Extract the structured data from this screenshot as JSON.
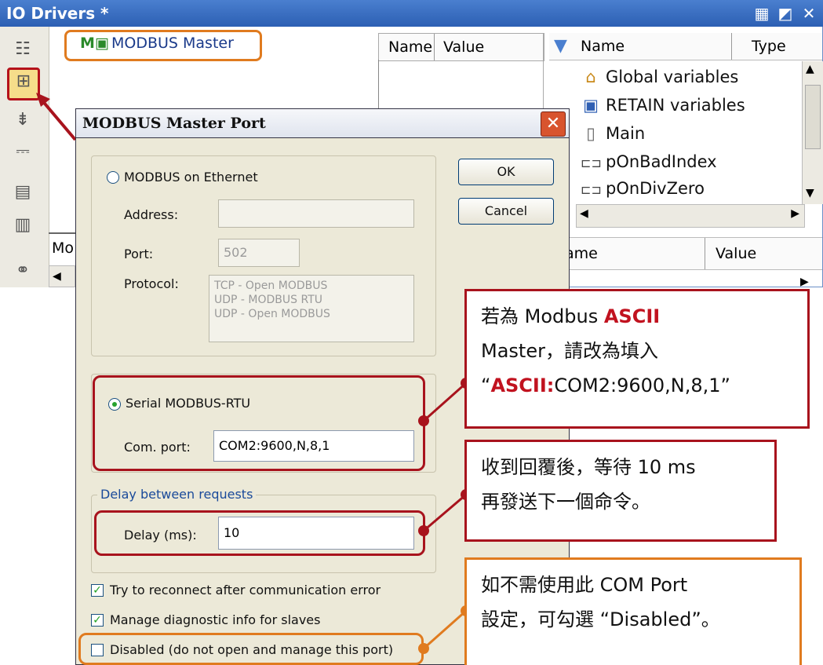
{
  "window": {
    "title": "IO Drivers *",
    "tree_item": "MODBUS Master",
    "mid_headers": [
      "Name",
      "Value"
    ],
    "right_headers": [
      "Name",
      "Type"
    ],
    "variables": [
      {
        "icon": "home-icon",
        "label": "Global variables"
      },
      {
        "icon": "save-icon",
        "label": "RETAIN variables"
      },
      {
        "icon": "document-icon",
        "label": "Main"
      },
      {
        "icon": "program-icon",
        "label": "pOnBadIndex"
      },
      {
        "icon": "program-icon",
        "label": "pOnDivZero"
      }
    ],
    "lower_headers": [
      "ame",
      "Value"
    ],
    "lower_left_cell": "Mo"
  },
  "dialog": {
    "title": "MODBUS Master Port",
    "ethernet_radio": "MODBUS on Ethernet",
    "address_label": "Address:",
    "address_value": "",
    "port_label": "Port:",
    "port_value": "502",
    "protocol_label": "Protocol:",
    "protocols": [
      "TCP - Open MODBUS",
      "UDP - MODBUS RTU",
      "UDP - Open MODBUS"
    ],
    "serial_radio": "Serial MODBUS-RTU",
    "com_port_label": "Com. port:",
    "com_port_value": "COM2:9600,N,8,1",
    "delay_group": "Delay between requests",
    "delay_label": "Delay (ms):",
    "delay_value": "10",
    "ok_button": "OK",
    "cancel_button": "Cancel",
    "checkboxes": [
      {
        "label": "Try to reconnect after communication error",
        "checked": true
      },
      {
        "label": "Manage diagnostic info for slaves",
        "checked": true
      },
      {
        "label": "Disabled (do not open and manage this port)",
        "checked": false
      }
    ]
  },
  "callouts": {
    "ascii": {
      "line1_pre": "若為  Modbus ",
      "line1_em": "ASCII",
      "line2": "Master，請改為填入",
      "line3_q1": "“",
      "line3_em": "ASCII:",
      "line3_rest": "COM2:9600,N,8,1”"
    },
    "delay": {
      "line1": "收到回覆後，等待  10 ms",
      "line2": "再發送下一個命令。"
    },
    "disabled": {
      "line1": "如不需使用此  COM Port",
      "line2": "設定，可勾選  “Disabled”。"
    }
  },
  "colors": {
    "highlight_red": "#a8131d",
    "highlight_orange": "#e07b1f",
    "title_blue": "#2c5fb3"
  }
}
